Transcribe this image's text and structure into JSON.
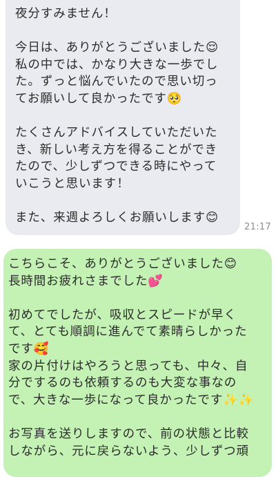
{
  "received_message": {
    "lines": [
      "夜分すみません！",
      "",
      "今日は、ありがとうございました😌",
      "私の中では、かなり大きな一歩でし",
      "た。ずっと悩んでいたので思い切っ",
      "てお願いして良かったです🥺",
      "",
      "たくさんアドバイスしていただいた",
      "き、新しい考え方を得ることができ",
      "たので、少しずつできる時にやって",
      "いこうと思います！",
      "",
      "また、来週よろしくお願いします😊"
    ],
    "time": "21:17"
  },
  "sent_message": {
    "lines": [
      "こちらこそ、ありがとうございました😊",
      "長時間お疲れさまでした💕",
      "",
      "初めてでしたが、吸収とスピードが早く",
      "て、とても順調に進んでて素晴らしかった",
      "です🥰",
      "家の片付けはやろうと思っても、中々、自",
      "分でするのも依頼するのも大変な事なの",
      "で、大きな一歩になって良かったです✨✨",
      "",
      "お写真を送りしますので、前の状態と比較",
      "しながら、元に戻らないよう、少しずつ頑"
    ]
  }
}
